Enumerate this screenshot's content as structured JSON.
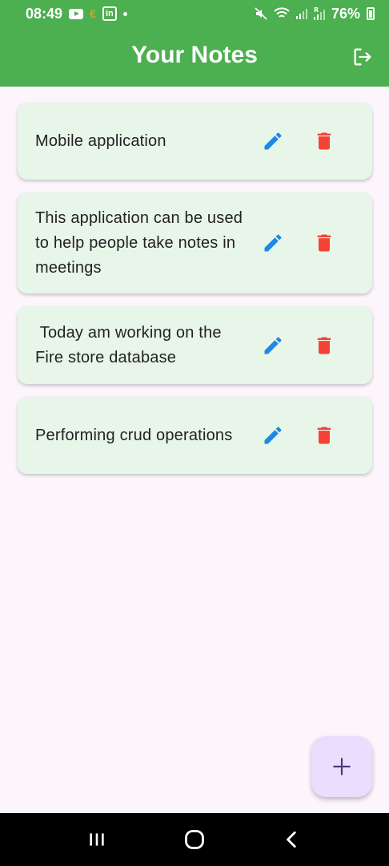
{
  "status_bar": {
    "time": "08:49",
    "battery": "76%",
    "icons": [
      "youtube-icon",
      "euro-icon",
      "linkedin-icon",
      "dot-icon",
      "mute-icon",
      "wifi-icon",
      "signal-icon",
      "signal-roaming-icon",
      "battery-icon"
    ]
  },
  "app_bar": {
    "title": "Your Notes",
    "logout_icon": "logout-icon",
    "color": "#4caf50"
  },
  "notes": [
    {
      "text": "Mobile application"
    },
    {
      "text": "This application can be used to help people take notes in meetings"
    },
    {
      "text": " Today am working on the Fire store database"
    },
    {
      "text": "Performing crud operations"
    }
  ],
  "note_actions": {
    "edit_icon": "edit-icon",
    "delete_icon": "delete-icon",
    "edit_color": "#1e88e5",
    "delete_color": "#f44336"
  },
  "fab": {
    "label": "+",
    "icon": "add-icon",
    "color": "#e9defd"
  },
  "nav_bar": {
    "icons": [
      "recent-apps-icon",
      "home-icon",
      "back-icon"
    ]
  }
}
